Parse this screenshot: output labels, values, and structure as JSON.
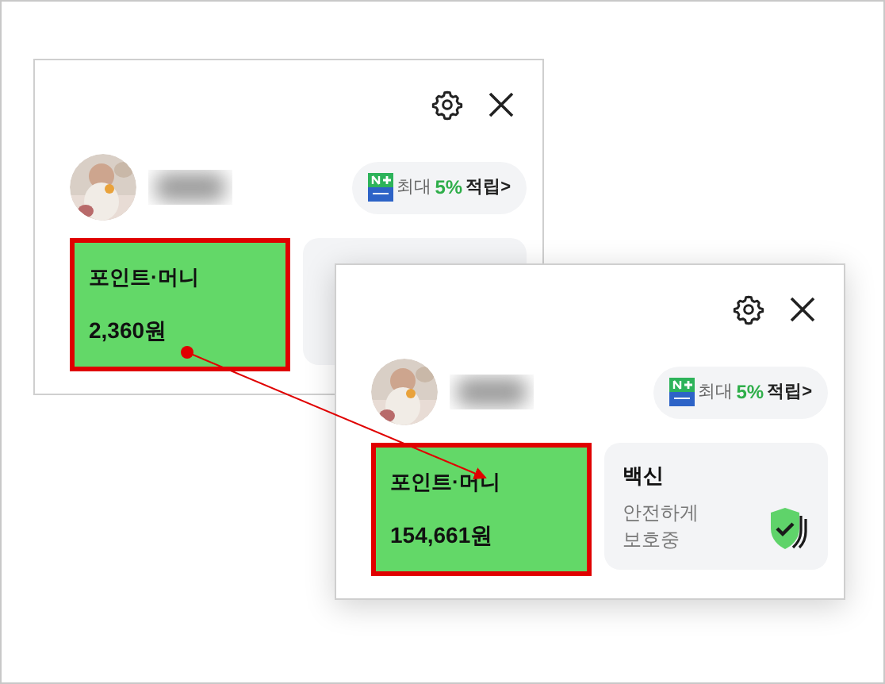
{
  "panels": [
    {
      "badge": {
        "prefix": "최대",
        "highlight": "5%",
        "suffix": "적립>"
      },
      "points": {
        "label": "포인트·머니",
        "amount": "2,360원",
        "highlighted": true
      }
    },
    {
      "badge": {
        "prefix": "최대",
        "highlight": "5%",
        "suffix": "적립>"
      },
      "points": {
        "label": "포인트·머니",
        "amount": "154,661원",
        "highlighted": true
      },
      "vaccine": {
        "title": "백신",
        "lines": [
          "안전하게",
          "보호중"
        ]
      }
    }
  ]
}
